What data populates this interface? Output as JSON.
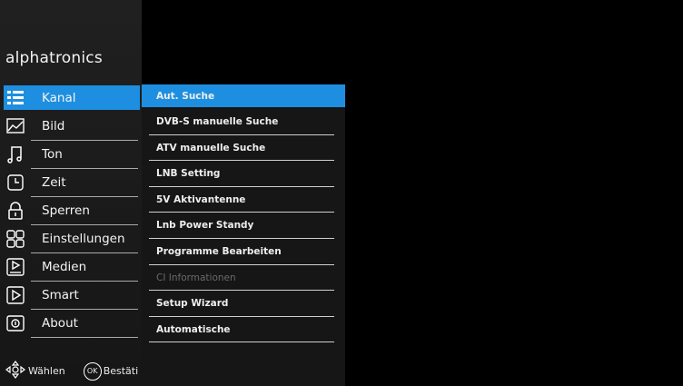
{
  "brand": "alphatronics",
  "main_menu": [
    {
      "label": "Kanal",
      "icon": "list-icon",
      "active": true
    },
    {
      "label": "Bild",
      "icon": "picture-icon"
    },
    {
      "label": "Ton",
      "icon": "music-note-icon"
    },
    {
      "label": "Zeit",
      "icon": "clock-icon"
    },
    {
      "label": "Sperren",
      "icon": "lock-icon"
    },
    {
      "label": "Einstellungen",
      "icon": "grid-icon"
    },
    {
      "label": "Medien",
      "icon": "media-icon"
    },
    {
      "label": "Smart",
      "icon": "play-icon"
    },
    {
      "label": "About",
      "icon": "info-icon"
    }
  ],
  "sub_menu": [
    {
      "label": "Aut. Suche",
      "active": true
    },
    {
      "label": "DVB-S manuelle Suche"
    },
    {
      "label": "ATV manuelle Suche"
    },
    {
      "label": "LNB Setting"
    },
    {
      "label": "5V Aktivantenne"
    },
    {
      "label": "Lnb Power Standy"
    },
    {
      "label": "Programme Bearbeiten"
    },
    {
      "label": "CI Informationen",
      "disabled": true
    },
    {
      "label": "Setup Wizard"
    },
    {
      "label": "Automatische"
    }
  ],
  "footer": {
    "nav_label": "Wählen",
    "ok_badge": "OK",
    "ok_label": "Bestäti"
  },
  "colors": {
    "accent": "#1e8fe0",
    "panel": "#1c1c1c",
    "background": "#000000"
  }
}
